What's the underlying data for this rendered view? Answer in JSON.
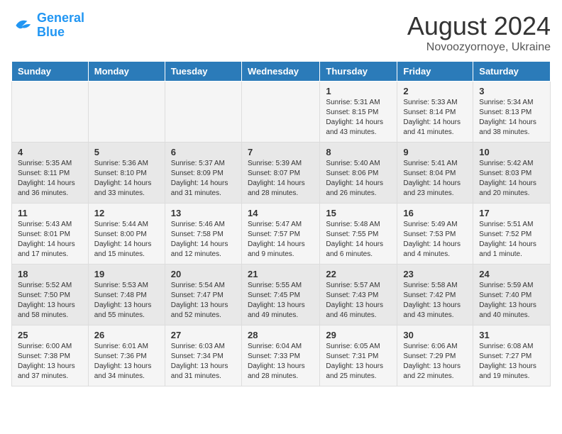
{
  "logo": {
    "line1": "General",
    "line2": "Blue"
  },
  "title": "August 2024",
  "subtitle": "Novoozyornoye, Ukraine",
  "headers": [
    "Sunday",
    "Monday",
    "Tuesday",
    "Wednesday",
    "Thursday",
    "Friday",
    "Saturday"
  ],
  "weeks": [
    [
      {
        "day": "",
        "sunrise": "",
        "sunset": "",
        "daylight": ""
      },
      {
        "day": "",
        "sunrise": "",
        "sunset": "",
        "daylight": ""
      },
      {
        "day": "",
        "sunrise": "",
        "sunset": "",
        "daylight": ""
      },
      {
        "day": "",
        "sunrise": "",
        "sunset": "",
        "daylight": ""
      },
      {
        "day": "1",
        "sunrise": "Sunrise: 5:31 AM",
        "sunset": "Sunset: 8:15 PM",
        "daylight": "Daylight: 14 hours and 43 minutes."
      },
      {
        "day": "2",
        "sunrise": "Sunrise: 5:33 AM",
        "sunset": "Sunset: 8:14 PM",
        "daylight": "Daylight: 14 hours and 41 minutes."
      },
      {
        "day": "3",
        "sunrise": "Sunrise: 5:34 AM",
        "sunset": "Sunset: 8:13 PM",
        "daylight": "Daylight: 14 hours and 38 minutes."
      }
    ],
    [
      {
        "day": "4",
        "sunrise": "Sunrise: 5:35 AM",
        "sunset": "Sunset: 8:11 PM",
        "daylight": "Daylight: 14 hours and 36 minutes."
      },
      {
        "day": "5",
        "sunrise": "Sunrise: 5:36 AM",
        "sunset": "Sunset: 8:10 PM",
        "daylight": "Daylight: 14 hours and 33 minutes."
      },
      {
        "day": "6",
        "sunrise": "Sunrise: 5:37 AM",
        "sunset": "Sunset: 8:09 PM",
        "daylight": "Daylight: 14 hours and 31 minutes."
      },
      {
        "day": "7",
        "sunrise": "Sunrise: 5:39 AM",
        "sunset": "Sunset: 8:07 PM",
        "daylight": "Daylight: 14 hours and 28 minutes."
      },
      {
        "day": "8",
        "sunrise": "Sunrise: 5:40 AM",
        "sunset": "Sunset: 8:06 PM",
        "daylight": "Daylight: 14 hours and 26 minutes."
      },
      {
        "day": "9",
        "sunrise": "Sunrise: 5:41 AM",
        "sunset": "Sunset: 8:04 PM",
        "daylight": "Daylight: 14 hours and 23 minutes."
      },
      {
        "day": "10",
        "sunrise": "Sunrise: 5:42 AM",
        "sunset": "Sunset: 8:03 PM",
        "daylight": "Daylight: 14 hours and 20 minutes."
      }
    ],
    [
      {
        "day": "11",
        "sunrise": "Sunrise: 5:43 AM",
        "sunset": "Sunset: 8:01 PM",
        "daylight": "Daylight: 14 hours and 17 minutes."
      },
      {
        "day": "12",
        "sunrise": "Sunrise: 5:44 AM",
        "sunset": "Sunset: 8:00 PM",
        "daylight": "Daylight: 14 hours and 15 minutes."
      },
      {
        "day": "13",
        "sunrise": "Sunrise: 5:46 AM",
        "sunset": "Sunset: 7:58 PM",
        "daylight": "Daylight: 14 hours and 12 minutes."
      },
      {
        "day": "14",
        "sunrise": "Sunrise: 5:47 AM",
        "sunset": "Sunset: 7:57 PM",
        "daylight": "Daylight: 14 hours and 9 minutes."
      },
      {
        "day": "15",
        "sunrise": "Sunrise: 5:48 AM",
        "sunset": "Sunset: 7:55 PM",
        "daylight": "Daylight: 14 hours and 6 minutes."
      },
      {
        "day": "16",
        "sunrise": "Sunrise: 5:49 AM",
        "sunset": "Sunset: 7:53 PM",
        "daylight": "Daylight: 14 hours and 4 minutes."
      },
      {
        "day": "17",
        "sunrise": "Sunrise: 5:51 AM",
        "sunset": "Sunset: 7:52 PM",
        "daylight": "Daylight: 14 hours and 1 minute."
      }
    ],
    [
      {
        "day": "18",
        "sunrise": "Sunrise: 5:52 AM",
        "sunset": "Sunset: 7:50 PM",
        "daylight": "Daylight: 13 hours and 58 minutes."
      },
      {
        "day": "19",
        "sunrise": "Sunrise: 5:53 AM",
        "sunset": "Sunset: 7:48 PM",
        "daylight": "Daylight: 13 hours and 55 minutes."
      },
      {
        "day": "20",
        "sunrise": "Sunrise: 5:54 AM",
        "sunset": "Sunset: 7:47 PM",
        "daylight": "Daylight: 13 hours and 52 minutes."
      },
      {
        "day": "21",
        "sunrise": "Sunrise: 5:55 AM",
        "sunset": "Sunset: 7:45 PM",
        "daylight": "Daylight: 13 hours and 49 minutes."
      },
      {
        "day": "22",
        "sunrise": "Sunrise: 5:57 AM",
        "sunset": "Sunset: 7:43 PM",
        "daylight": "Daylight: 13 hours and 46 minutes."
      },
      {
        "day": "23",
        "sunrise": "Sunrise: 5:58 AM",
        "sunset": "Sunset: 7:42 PM",
        "daylight": "Daylight: 13 hours and 43 minutes."
      },
      {
        "day": "24",
        "sunrise": "Sunrise: 5:59 AM",
        "sunset": "Sunset: 7:40 PM",
        "daylight": "Daylight: 13 hours and 40 minutes."
      }
    ],
    [
      {
        "day": "25",
        "sunrise": "Sunrise: 6:00 AM",
        "sunset": "Sunset: 7:38 PM",
        "daylight": "Daylight: 13 hours and 37 minutes."
      },
      {
        "day": "26",
        "sunrise": "Sunrise: 6:01 AM",
        "sunset": "Sunset: 7:36 PM",
        "daylight": "Daylight: 13 hours and 34 minutes."
      },
      {
        "day": "27",
        "sunrise": "Sunrise: 6:03 AM",
        "sunset": "Sunset: 7:34 PM",
        "daylight": "Daylight: 13 hours and 31 minutes."
      },
      {
        "day": "28",
        "sunrise": "Sunrise: 6:04 AM",
        "sunset": "Sunset: 7:33 PM",
        "daylight": "Daylight: 13 hours and 28 minutes."
      },
      {
        "day": "29",
        "sunrise": "Sunrise: 6:05 AM",
        "sunset": "Sunset: 7:31 PM",
        "daylight": "Daylight: 13 hours and 25 minutes."
      },
      {
        "day": "30",
        "sunrise": "Sunrise: 6:06 AM",
        "sunset": "Sunset: 7:29 PM",
        "daylight": "Daylight: 13 hours and 22 minutes."
      },
      {
        "day": "31",
        "sunrise": "Sunrise: 6:08 AM",
        "sunset": "Sunset: 7:27 PM",
        "daylight": "Daylight: 13 hours and 19 minutes."
      }
    ]
  ]
}
